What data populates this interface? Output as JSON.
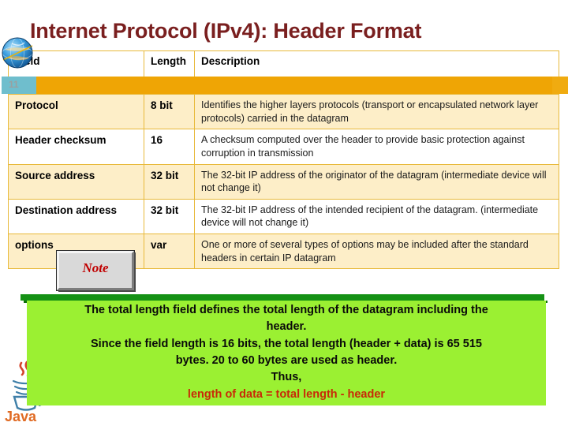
{
  "slide": {
    "title": "Internet Protocol (IPv4): Header Format",
    "number": "11",
    "accent_orange": "#efa505",
    "accent_teal": "#6fbecd",
    "title_color": "#7a1f1f",
    "table_border": "#e8b93a",
    "row_tint": "#fdeec8",
    "callout_green": "#9bf032",
    "callout_bar_green": "#159115",
    "callout_accent_red": "#c82a08"
  },
  "decorations": {
    "globe_icon": "globe-icon",
    "java_logo": "java-logo",
    "java_wordmark": "Java"
  },
  "note_button": {
    "label": "Note"
  },
  "table": {
    "columns": [
      "Field",
      "Length",
      "Description"
    ],
    "header_length_display": "Lengt h",
    "rows": [
      {
        "field": "Protocol",
        "length": "8 bit",
        "description": "Identifies the higher layers protocols (transport or encapsulated network layer protocols) carried in the datagram"
      },
      {
        "field": "Header checksum",
        "length": "16",
        "description": "A checksum computed over the header to provide basic protection against corruption in transmission"
      },
      {
        "field": "Source address",
        "length": "32 bit",
        "description": "The 32-bit IP address of the originator of the datagram (intermediate device will not change it)"
      },
      {
        "field": "Destination address",
        "length": "32 bit",
        "description": "The 32-bit IP address of the intended recipient of the datagram. (intermediate device will not change it)"
      },
      {
        "field": "options",
        "length": "var",
        "description": "One or more of several types of options may be included after the standard headers in certain IP datagram"
      }
    ]
  },
  "callout": {
    "lines": [
      {
        "text": "The total length field defines the total length of the datagram including the",
        "accent": false
      },
      {
        "text": "header.",
        "accent": false
      },
      {
        "text": "Since the field length is 16 bits, the total length  (header + data) is 65 515",
        "accent": false
      },
      {
        "text": "bytes. 20 to 60 bytes are used as header.",
        "accent": false
      },
      {
        "text": "Thus,",
        "accent": false
      },
      {
        "text": "length of data = total length - header",
        "accent": true
      }
    ]
  }
}
